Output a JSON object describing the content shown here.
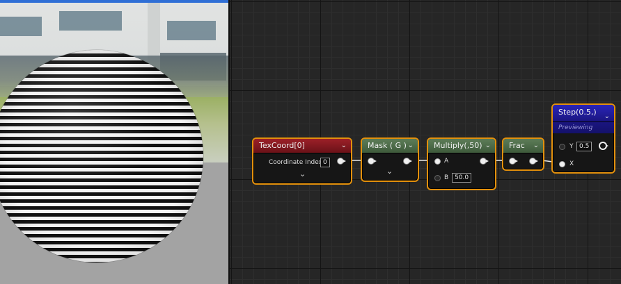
{
  "nodes": {
    "texcoord": {
      "title": "TexCoord[0]",
      "param_label": "Coordinate Index",
      "param_value": "0"
    },
    "mask": {
      "title": "Mask ( G )"
    },
    "multiply": {
      "title": "Multiply(,50)",
      "pin_a_label": "A",
      "pin_b_label": "B",
      "pin_b_value": "50.0"
    },
    "frac": {
      "title": "Frac"
    },
    "step": {
      "title": "Step(0.5,)",
      "status": "Previewing",
      "pin_y_label": "Y",
      "pin_y_value": "0.5",
      "pin_x_label": "X"
    }
  },
  "icons": {
    "dropdown": "chevron-down-icon",
    "expand": "chevron-down-icon"
  },
  "colors": {
    "selection_border": "#e3900c",
    "texcoord_header": "#9c2028",
    "math_header": "#5d7d58",
    "step_header": "#2a25b8",
    "viewport_accent": "#2f6fd6"
  }
}
